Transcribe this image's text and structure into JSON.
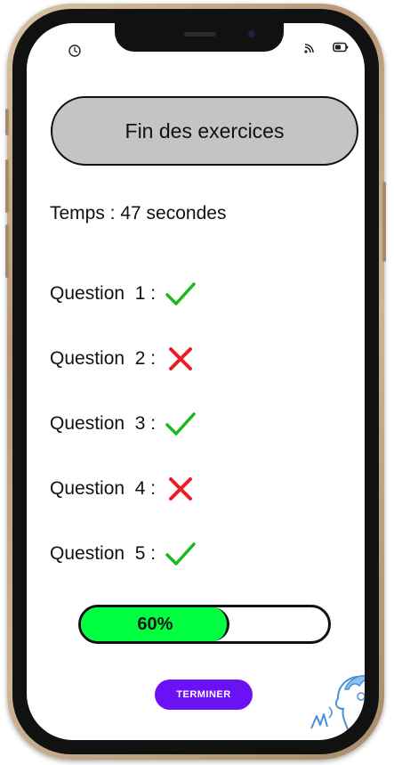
{
  "status_bar": {
    "left_icon": "clock-icon",
    "right_icons": [
      "cast-icon",
      "battery-icon"
    ]
  },
  "header": {
    "title": "Fin des exercices"
  },
  "summary": {
    "time_text": "Temps : 47 secondes"
  },
  "questions": [
    {
      "label": "Question  1 :",
      "result": "correct",
      "icon": "check-icon"
    },
    {
      "label": "Question  2 :",
      "result": "incorrect",
      "icon": "cross-icon"
    },
    {
      "label": "Question  3 :",
      "result": "correct",
      "icon": "check-icon"
    },
    {
      "label": "Question  4 :",
      "result": "incorrect",
      "icon": "cross-icon"
    },
    {
      "label": "Question  5 :",
      "result": "correct",
      "icon": "check-icon"
    }
  ],
  "progress": {
    "value": 0.6,
    "label": "60%"
  },
  "actions": {
    "finish_label": "TERMINER"
  },
  "colors": {
    "correct": "#19b91e",
    "incorrect": "#ee1c24",
    "progress_fill": "#00ff41",
    "button": "#6a12f4",
    "title_bg": "#c4c4c4",
    "frame_gold": "#c8ad8c"
  }
}
